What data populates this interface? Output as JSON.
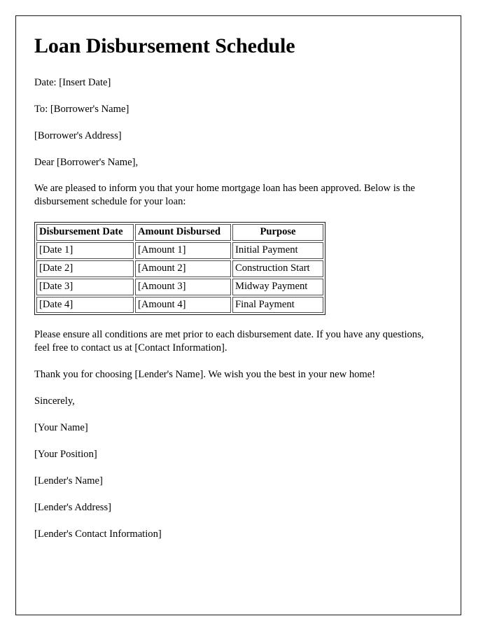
{
  "document": {
    "title": "Loan Disbursement Schedule",
    "date_line": "Date: [Insert Date]",
    "to_line": "To: [Borrower's Name]",
    "address_line": "[Borrower's Address]",
    "salutation": "Dear [Borrower's Name],",
    "intro_paragraph": "We are pleased to inform you that your home mortgage loan has been approved. Below is the disbursement schedule for your loan:",
    "conditions_paragraph": "Please ensure all conditions are met prior to each disbursement date. If you have any questions, feel free to contact us at [Contact Information].",
    "thanks_paragraph": "Thank you for choosing [Lender's Name]. We wish you the best in your new home!",
    "closing": "Sincerely,",
    "signature_block": [
      "[Your Name]",
      "[Your Position]",
      "[Lender's Name]",
      "[Lender's Address]",
      "[Lender's Contact Information]"
    ]
  },
  "schedule_table": {
    "headers": [
      "Disbursement Date",
      "Amount Disbursed",
      "Purpose"
    ],
    "rows": [
      {
        "date": "[Date 1]",
        "amount": "[Amount 1]",
        "purpose": "Initial Payment"
      },
      {
        "date": "[Date 2]",
        "amount": "[Amount 2]",
        "purpose": "Construction Start"
      },
      {
        "date": "[Date 3]",
        "amount": "[Amount 3]",
        "purpose": "Midway Payment"
      },
      {
        "date": "[Date 4]",
        "amount": "[Amount 4]",
        "purpose": "Final Payment"
      }
    ]
  },
  "colors": {
    "page_background": "#ffffff",
    "text": "#000000",
    "page_border": "#1a1a1a",
    "table_cell_border": "#4d4d4d"
  }
}
